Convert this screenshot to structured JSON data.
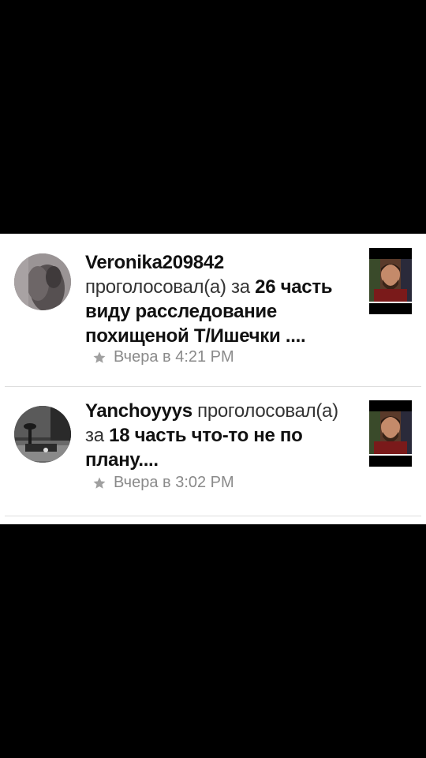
{
  "notifications": [
    {
      "username": "Veronika209842",
      "action": "проголосовал(а) за",
      "story": "26 часть виду расследование похищеной Т/Ишечки ....",
      "time": "Вчера в 4:21 PM",
      "icon": "star-icon"
    },
    {
      "username": "Yanchoyyys",
      "action": "проголосовал(а) за",
      "story": "18 часть что-то не по плану....",
      "time": "Вчера в 3:02 PM",
      "icon": "star-icon"
    }
  ],
  "colors": {
    "background": "#000000",
    "panel": "#ffffff",
    "text": "#1a1a1a",
    "meta": "#8a8a8a",
    "divider": "#dedede"
  }
}
